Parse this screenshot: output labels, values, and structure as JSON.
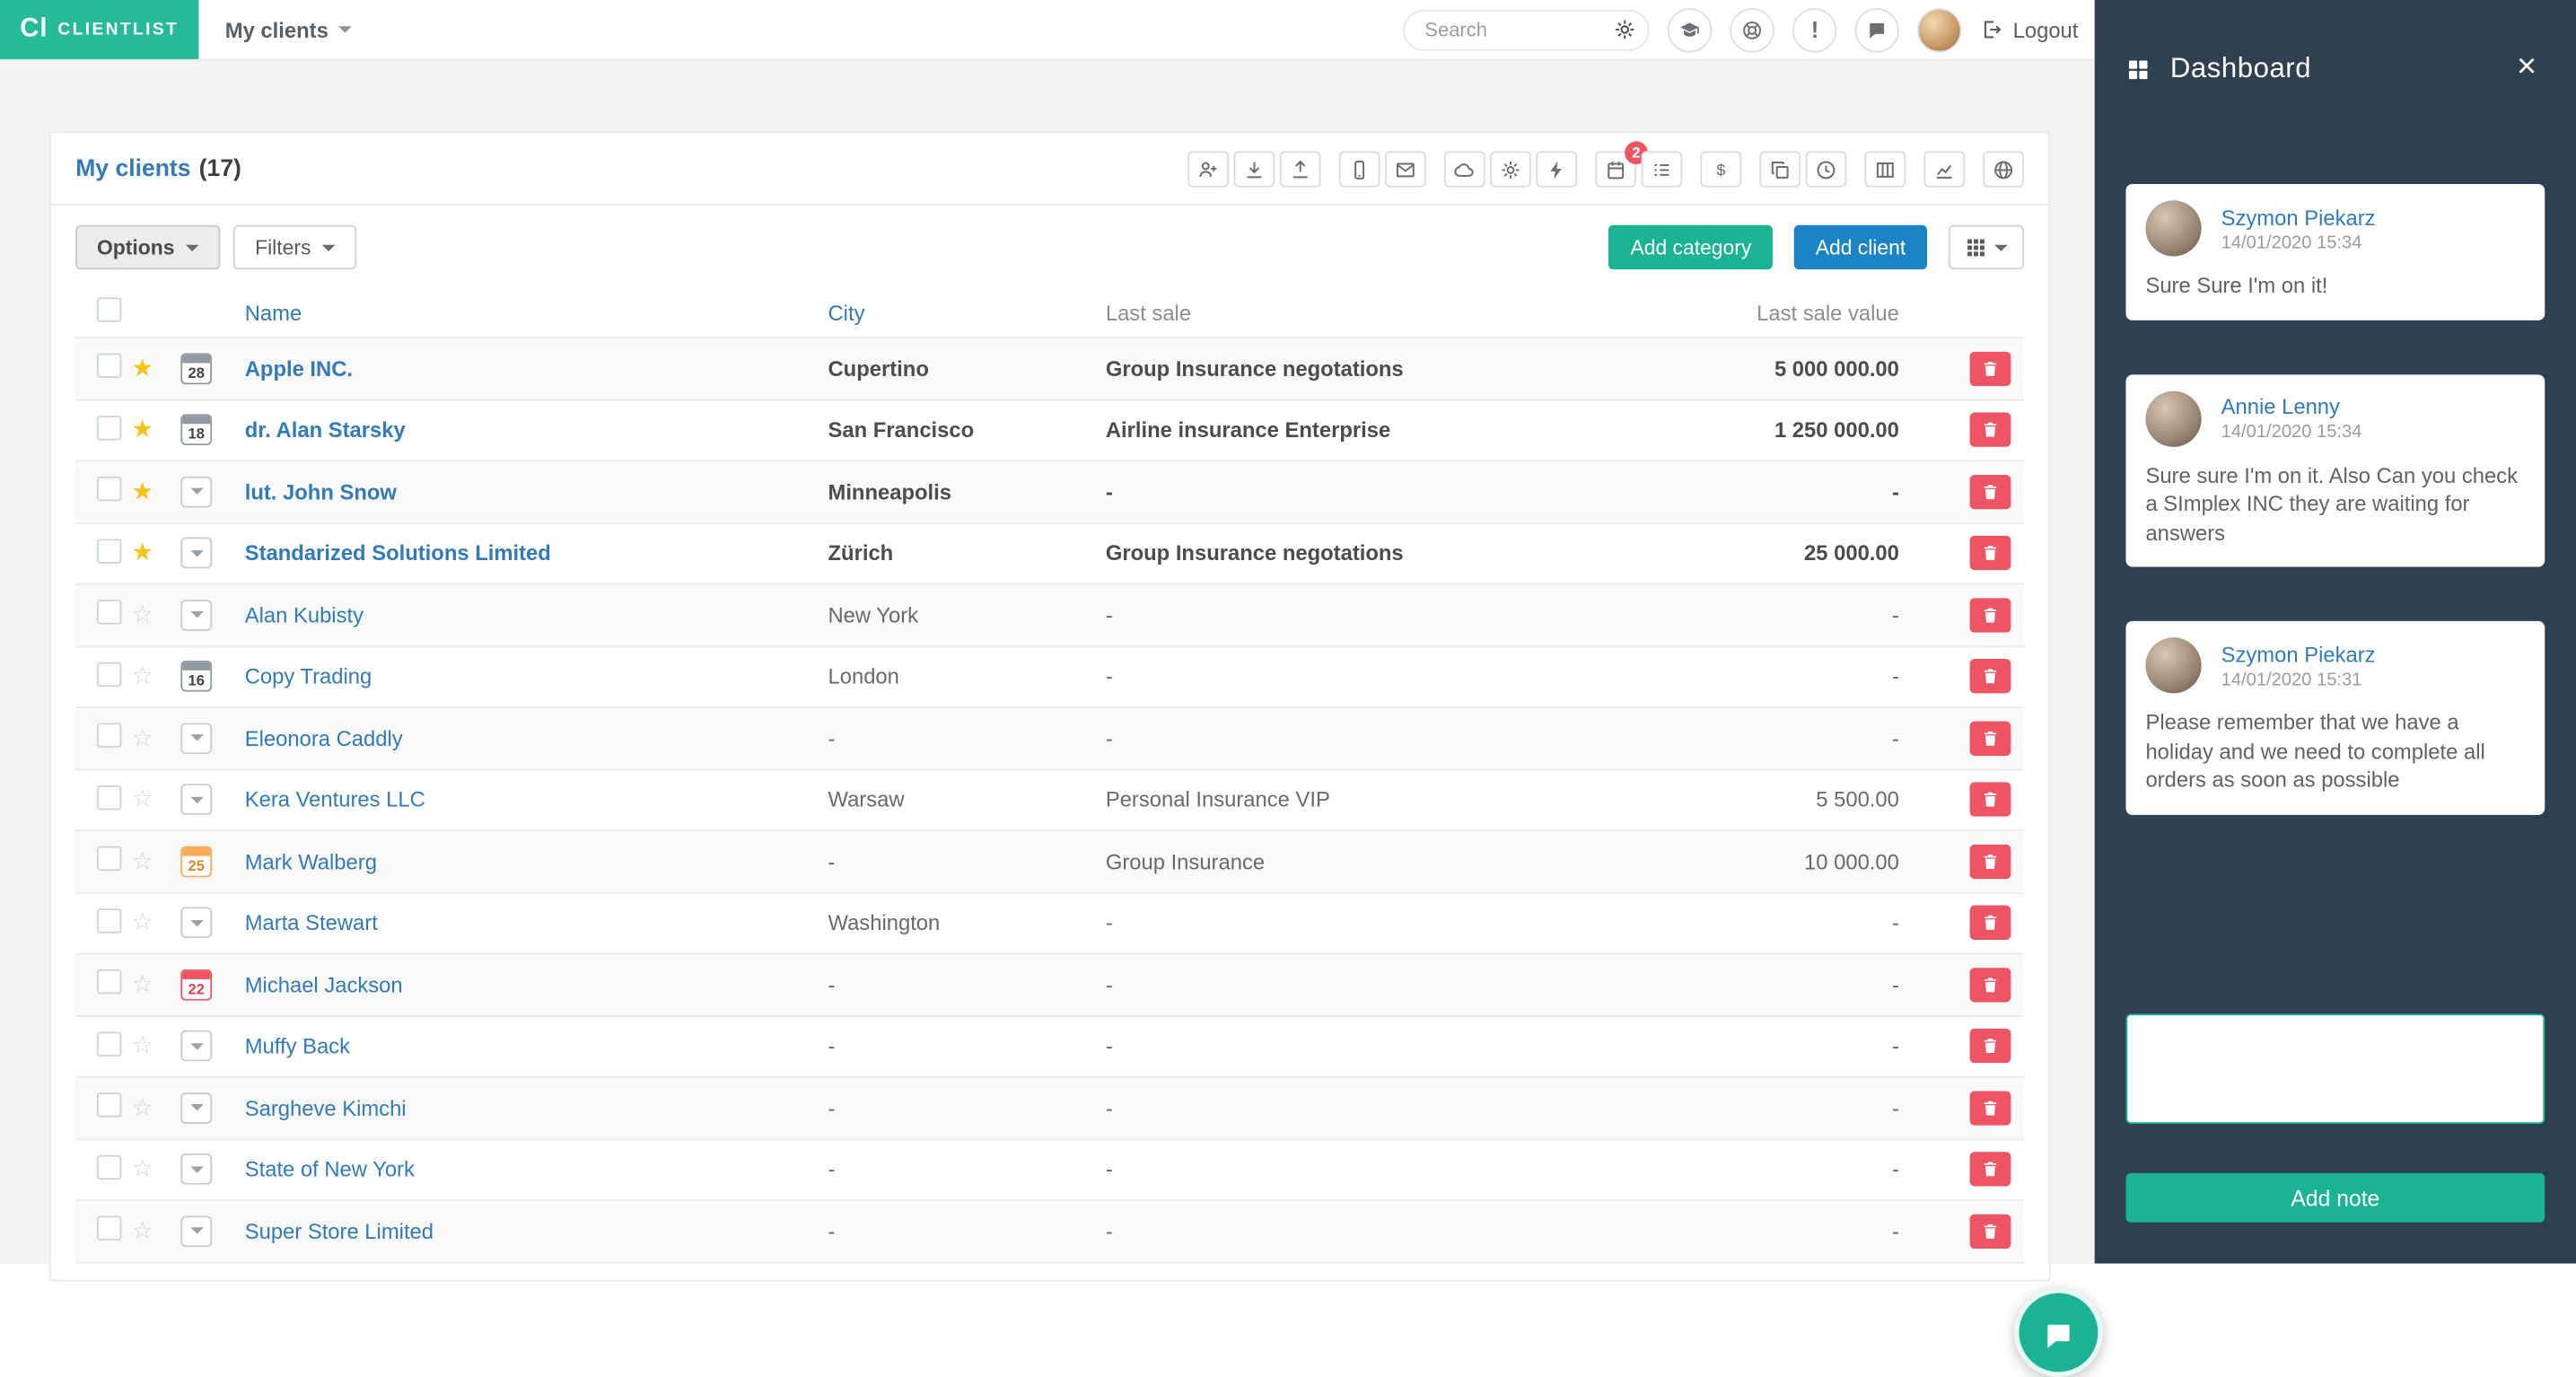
{
  "navbar": {
    "logo_mark": "Cl",
    "logo_text": "CLIENTLIST",
    "active_menu": "My clients",
    "search_placeholder": "Search",
    "logout_label": "Logout"
  },
  "card_header": {
    "title": "My clients",
    "count": "(17)"
  },
  "card_toolbar": {
    "icons": [
      {
        "name": "add-user",
        "symbol": "user-plus"
      },
      {
        "name": "download",
        "symbol": "download"
      },
      {
        "name": "upload",
        "symbol": "upload"
      },
      {
        "name": "mobile",
        "symbol": "mobile"
      },
      {
        "name": "email",
        "symbol": "envelope"
      },
      {
        "name": "cloud",
        "symbol": "cloud"
      },
      {
        "name": "settings",
        "symbol": "gear"
      },
      {
        "name": "automation",
        "symbol": "bolt"
      },
      {
        "name": "calendar",
        "symbol": "calendar",
        "badge": "2"
      },
      {
        "name": "tasks",
        "symbol": "list"
      },
      {
        "name": "sales",
        "symbol": "dollar"
      },
      {
        "name": "duplicate",
        "symbol": "copy"
      },
      {
        "name": "history",
        "symbol": "clock"
      },
      {
        "name": "columns",
        "symbol": "columns"
      },
      {
        "name": "reports",
        "symbol": "chart"
      },
      {
        "name": "web",
        "symbol": "globe"
      }
    ]
  },
  "actions": {
    "options_label": "Options",
    "filters_label": "Filters",
    "add_category_label": "Add category",
    "add_client_label": "Add client"
  },
  "table": {
    "headers": {
      "name": "Name",
      "city": "City",
      "last_sale": "Last sale",
      "last_sale_value": "Last sale value"
    },
    "rows": [
      {
        "name": "Apple INC.",
        "city": "Cupertino",
        "last_sale": "Group Insurance negotations",
        "last_sale_value": "5 000 000.00",
        "starred": true,
        "bold": true,
        "icon": "calendar",
        "day": "28",
        "icon_color": "gray"
      },
      {
        "name": "dr. Alan Starsky",
        "city": "San Francisco",
        "last_sale": "Airline insurance Enterprise",
        "last_sale_value": "1 250 000.00",
        "starred": true,
        "bold": true,
        "icon": "calendar",
        "day": "18",
        "icon_color": "gray"
      },
      {
        "name": "lut. John Snow",
        "city": "Minneapolis",
        "last_sale": "-",
        "last_sale_value": "-",
        "starred": true,
        "bold": true,
        "icon": "dropdown"
      },
      {
        "name": "Standarized Solutions Limited",
        "city": "Zürich",
        "last_sale": "Group Insurance negotations",
        "last_sale_value": "25 000.00",
        "starred": true,
        "bold": true,
        "icon": "dropdown"
      },
      {
        "name": "Alan Kubisty",
        "city": "New York",
        "last_sale": "-",
        "last_sale_value": "-",
        "starred": false,
        "bold": false,
        "icon": "dropdown"
      },
      {
        "name": "Copy Trading",
        "city": "London",
        "last_sale": "-",
        "last_sale_value": "-",
        "starred": false,
        "bold": false,
        "icon": "calendar",
        "day": "16",
        "icon_color": "gray"
      },
      {
        "name": "Eleonora Caddly",
        "city": "-",
        "last_sale": "-",
        "last_sale_value": "-",
        "starred": false,
        "bold": false,
        "icon": "dropdown"
      },
      {
        "name": "Kera Ventures LLC",
        "city": "Warsaw",
        "last_sale": "Personal Insurance VIP",
        "last_sale_value": "5 500.00",
        "starred": false,
        "bold": false,
        "icon": "dropdown"
      },
      {
        "name": "Mark Walberg",
        "city": "-",
        "last_sale": "Group Insurance",
        "last_sale_value": "10 000.00",
        "starred": false,
        "bold": false,
        "icon": "calendar",
        "day": "25",
        "icon_color": "orange"
      },
      {
        "name": "Marta Stewart",
        "city": "Washington",
        "last_sale": "-",
        "last_sale_value": "-",
        "starred": false,
        "bold": false,
        "icon": "dropdown"
      },
      {
        "name": "Michael Jackson",
        "city": "-",
        "last_sale": "-",
        "last_sale_value": "-",
        "starred": false,
        "bold": false,
        "icon": "calendar",
        "day": "22",
        "icon_color": "red"
      },
      {
        "name": "Muffy Back",
        "city": "-",
        "last_sale": "-",
        "last_sale_value": "-",
        "starred": false,
        "bold": false,
        "icon": "dropdown"
      },
      {
        "name": "Sargheve Kimchi",
        "city": "-",
        "last_sale": "-",
        "last_sale_value": "-",
        "starred": false,
        "bold": false,
        "icon": "dropdown"
      },
      {
        "name": "State of New York",
        "city": "-",
        "last_sale": "-",
        "last_sale_value": "-",
        "starred": false,
        "bold": false,
        "icon": "dropdown"
      },
      {
        "name": "Super Store Limited",
        "city": "-",
        "last_sale": "-",
        "last_sale_value": "-",
        "starred": false,
        "bold": false,
        "icon": "dropdown"
      }
    ]
  },
  "dashboard": {
    "title": "Dashboard",
    "notes": [
      {
        "author": "Szymon Piekarz",
        "time": "14/01/2020 15:34",
        "text": "Sure Sure I'm on it!"
      },
      {
        "author": "Annie Lenny",
        "time": "14/01/2020 15:34",
        "text": "Sure sure I'm on it. Also Can you check a SImplex INC they are waiting for answers"
      },
      {
        "author": "Szymon Piekarz",
        "time": "14/01/2020 15:31",
        "text": "Please remember that we have a holiday and we need to complete all orders as soon as possible"
      }
    ],
    "note_input_value": "",
    "add_note_label": "Add note"
  },
  "colors": {
    "brand_teal": "#1ab394",
    "logo_teal": "#26b99a",
    "info_blue": "#1c84c6",
    "danger_red": "#ed5565",
    "link_blue": "#337ab7",
    "panel_dark": "#2f4050",
    "star_yellow": "#f6c21c"
  }
}
